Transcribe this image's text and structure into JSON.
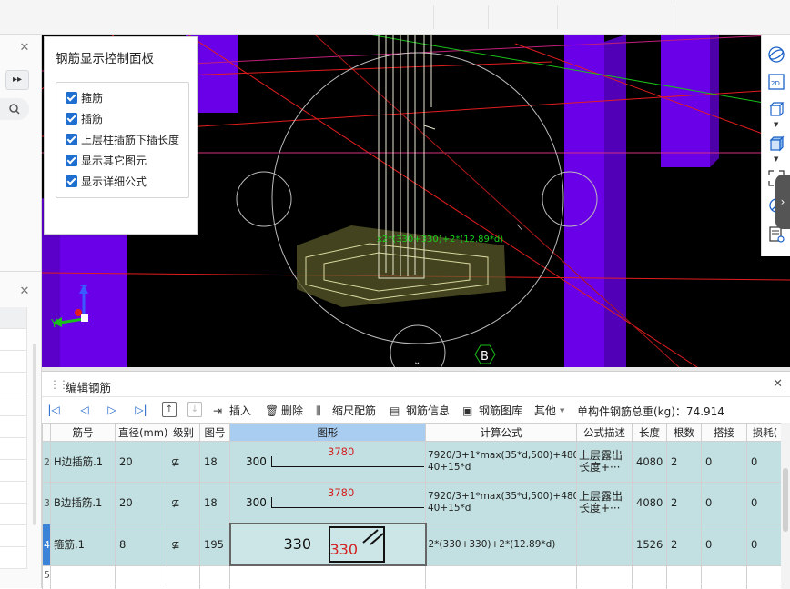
{
  "control_panel": {
    "title": "钢筋显示控制面板",
    "options": [
      "箍筋",
      "插筋",
      "上层柱插筋下插长度",
      "显示其它图元",
      "显示详细公式"
    ]
  },
  "viewport": {
    "label_green": "x2*(330+330)+2*(12.89*d)",
    "axis_label": "B",
    "axes": {
      "z": "Z",
      "y": "Y"
    }
  },
  "view_toolbar": {
    "icons": [
      "orbit-icon",
      "view-2d-icon",
      "cube-top-icon",
      "cube-solid-icon",
      "selection-icon",
      "settings-view-icon"
    ],
    "label_2d": "2D"
  },
  "edit_panel": {
    "title": "编辑钢筋",
    "toolbar": {
      "insert": "插入",
      "delete": "删除",
      "scale": "缩尺配筋",
      "info": "钢筋信息",
      "library": "钢筋图库",
      "other": "其他",
      "total_label": "单构件钢筋总重(kg)：74.914"
    },
    "columns": [
      "筋号",
      "直径(mm)",
      "级别",
      "图号",
      "图形",
      "计算公式",
      "公式描述",
      "长度",
      "根数",
      "搭接",
      "损耗("
    ],
    "rows": [
      {
        "rn": "2",
        "name": "H边插筋.1",
        "dia": "20",
        "grade": "⊈",
        "fig": "18",
        "shape_left": "300",
        "shape_top": "3780",
        "formula": "7920/3+1*max(35*d,500)+480-40+15*d",
        "desc": "上层露出长度+···",
        "length": "4080",
        "count": "2",
        "lap": "0",
        "loss": "0"
      },
      {
        "rn": "3",
        "name": "B边插筋.1",
        "dia": "20",
        "grade": "⊈",
        "fig": "18",
        "shape_left": "300",
        "shape_top": "3780",
        "formula": "7920/3+1*max(35*d,500)+480-40+15*d",
        "desc": "上层露出长度+···",
        "length": "4080",
        "count": "2",
        "lap": "0",
        "loss": "0"
      },
      {
        "rn": "4",
        "name": "箍筋.1",
        "dia": "8",
        "grade": "⊈",
        "fig": "195",
        "shape_left": "330",
        "shape_top": "330",
        "formula": "2*(330+330)+2*(12.89*d)",
        "desc": "",
        "length": "1526",
        "count": "2",
        "lap": "0",
        "loss": "0"
      }
    ],
    "empty_row": "5"
  },
  "colors": {
    "column_purple": "#6a00e8",
    "grid_red": "#e21d1d",
    "row_teal": "#c2e0e1",
    "selected_blue": "#3a83d8",
    "accent_blue": "#1f6fd0"
  }
}
